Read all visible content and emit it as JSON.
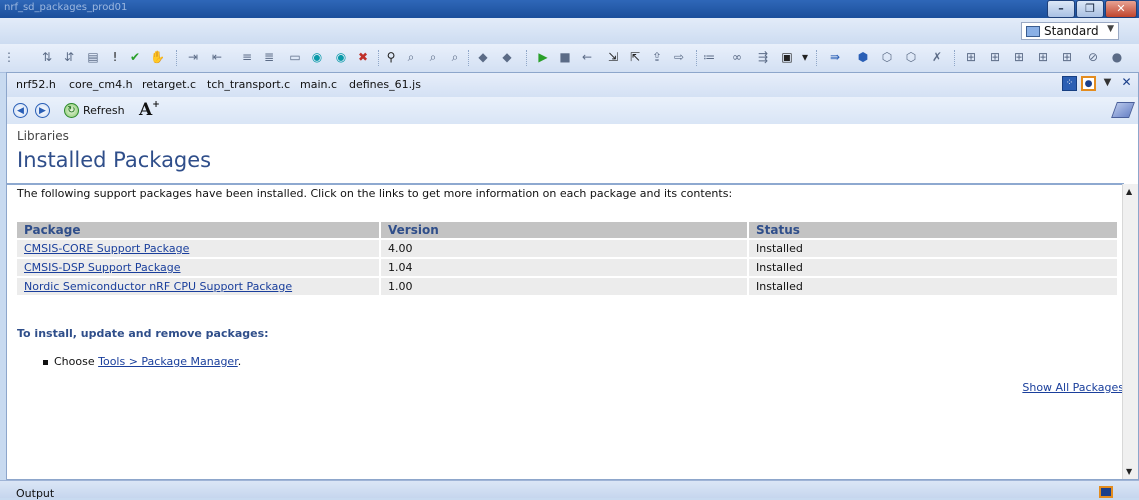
{
  "window": {
    "title": "nrf_sd_packages_prod01"
  },
  "command_bar": {
    "config_combo": "Standard"
  },
  "tabs": [
    "nrf52.h",
    "core_cm4.h",
    "retarget.c",
    "tch_transport.c",
    "main.c",
    "defines_61.js"
  ],
  "nav": {
    "refresh_label": "Refresh"
  },
  "page": {
    "breadcrumb": "Libraries",
    "title": "Installed Packages",
    "intro": "The following support packages have been installed. Click on the links to get more information on each package and its contents:",
    "table": {
      "headers": [
        "Package",
        "Version",
        "Status"
      ],
      "rows": [
        {
          "package": "CMSIS-CORE Support Package",
          "version": "4.00",
          "status": "Installed"
        },
        {
          "package": "CMSIS-DSP Support Package",
          "version": "1.04",
          "status": "Installed"
        },
        {
          "package": "Nordic Semiconductor nRF CPU Support Package",
          "version": "1.00",
          "status": "Installed"
        }
      ]
    },
    "install_heading": "To install, update and remove packages:",
    "bullet_prefix": "Choose ",
    "bullet_link": "Tools > Package Manager",
    "bullet_suffix": ".",
    "show_all": "Show All Packages"
  },
  "output_panel": {
    "label": "Output"
  },
  "colors": {
    "heading_blue": "#2f4e8a",
    "link_blue": "#1a3f9c",
    "header_gray": "#c3c3c3",
    "row_gray": "#ececec"
  }
}
